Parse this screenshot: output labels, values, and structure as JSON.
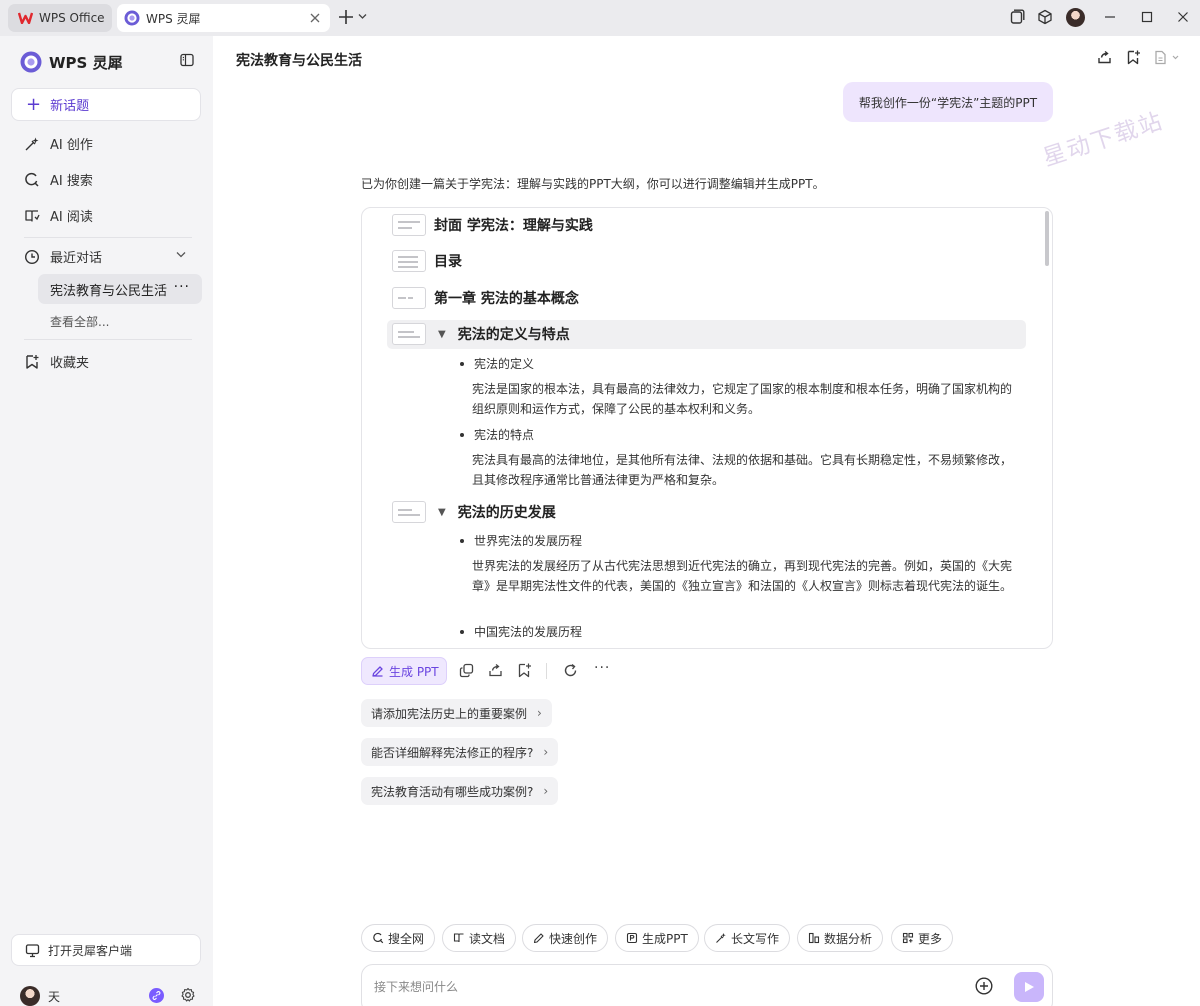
{
  "tabs": [
    {
      "label": "WPS Office"
    },
    {
      "label": "WPS 灵犀"
    }
  ],
  "sidebar": {
    "brand": "WPS 灵犀",
    "new_topic": "新话题",
    "nav": [
      {
        "label": "AI 创作",
        "icon": "sparkle-pen-icon"
      },
      {
        "label": "AI 搜索",
        "icon": "search-icon"
      },
      {
        "label": "AI 阅读",
        "icon": "book-icon"
      }
    ],
    "recent_label": "最近对话",
    "recent_active": "宪法教育与公民生活",
    "view_all": "查看全部...",
    "favorites": "收藏夹",
    "open_client": "打开灵犀客户端",
    "user_name": "天"
  },
  "main": {
    "title": "宪法教育与公民生活",
    "user_message": "帮我创作一份“学宪法”主题的PPT",
    "watermark": "星动下载站",
    "intro": "已为你创建一篇关于学宪法：理解与实践的PPT大纲，你可以进行调整编辑并生成PPT。",
    "outline": {
      "cover": "封面 学宪法：理解与实践",
      "toc": "目录",
      "chapter1": "第一章 宪法的基本概念",
      "sections": [
        {
          "title": "宪法的定义与特点",
          "points": [
            {
              "label": "宪法的定义",
              "text": "宪法是国家的根本法，具有最高的法律效力，它规定了国家的根本制度和根本任务，明确了国家机构的组织原则和运作方式，保障了公民的基本权利和义务。"
            },
            {
              "label": "宪法的特点",
              "text": "宪法具有最高的法律地位，是其他所有法律、法规的依据和基础。它具有长期稳定性，不易频繁修改，且其修改程序通常比普通法律更为严格和复杂。"
            }
          ]
        },
        {
          "title": "宪法的历史发展",
          "points": [
            {
              "label": "世界宪法的发展历程",
              "text": "世界宪法的发展经历了从古代宪法思想到近代宪法的确立，再到现代宪法的完善。例如，英国的《大宪章》是早期宪法性文件的代表，美国的《独立宣言》和法国的《人权宣言》则标志着现代宪法的诞生。"
            },
            {
              "label": "中国宪法的发展历程",
              "text": ""
            }
          ]
        }
      ]
    },
    "generate_ppt": "生成 PPT",
    "suggestions": [
      "请添加宪法历史上的重要案例",
      "能否详细解释宪法修正的程序?",
      "宪法教育活动有哪些成功案例?"
    ],
    "chips": [
      "搜全网",
      "读文档",
      "快速创作",
      "生成PPT",
      "长文写作",
      "数据分析",
      "更多"
    ],
    "input_placeholder": "接下来想问什么"
  },
  "colors": {
    "accent": "#6a45e0",
    "bubble": "#eee5fd",
    "send": "#c9b6fb"
  }
}
